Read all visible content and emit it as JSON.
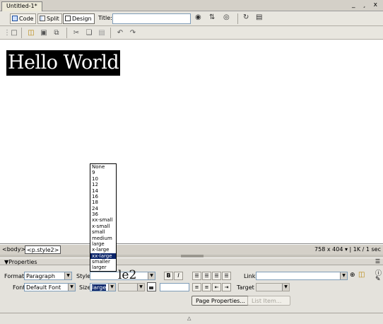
{
  "document_tab": {
    "title": "Untitled-1*"
  },
  "window_controls": "_ ¸ x",
  "doc_toolbar": {
    "code_label": "Code",
    "split_label": "Split",
    "design_label": "Design",
    "title_label": "Title:",
    "title_value": ""
  },
  "design_view": {
    "content_text": "Hello World"
  },
  "status_bar": {
    "tag_body": "<body>",
    "tag_p": "<p.style2>",
    "window_size": "758 x 404 ▾",
    "download": "1K / 1 sec"
  },
  "properties": {
    "title": "▼Properties",
    "format_label": "Format",
    "format_value": "Paragraph",
    "style_label": "Style",
    "style_preview": "le2",
    "link_label": "Link",
    "link_value": "",
    "font_label": "Font",
    "font_value": "Default Font",
    "size_label": "Size",
    "size_value": "large",
    "target_label": "Target",
    "target_value": "",
    "bold": "B",
    "italic": "I",
    "page_properties_button": "Page Properties...",
    "list_item_button": "List Item..."
  },
  "size_dropdown": {
    "options": [
      "None",
      "9",
      "10",
      "12",
      "14",
      "16",
      "18",
      "24",
      "36",
      "xx-small",
      "x-small",
      "small",
      "medium",
      "large",
      "x-large",
      "xx-large",
      "smaller",
      "larger"
    ],
    "highlighted": "xx-large"
  },
  "colors": {
    "chrome": "#d4d0c8",
    "selection": "#0a246a",
    "text_highlight_bg": "#000000"
  }
}
